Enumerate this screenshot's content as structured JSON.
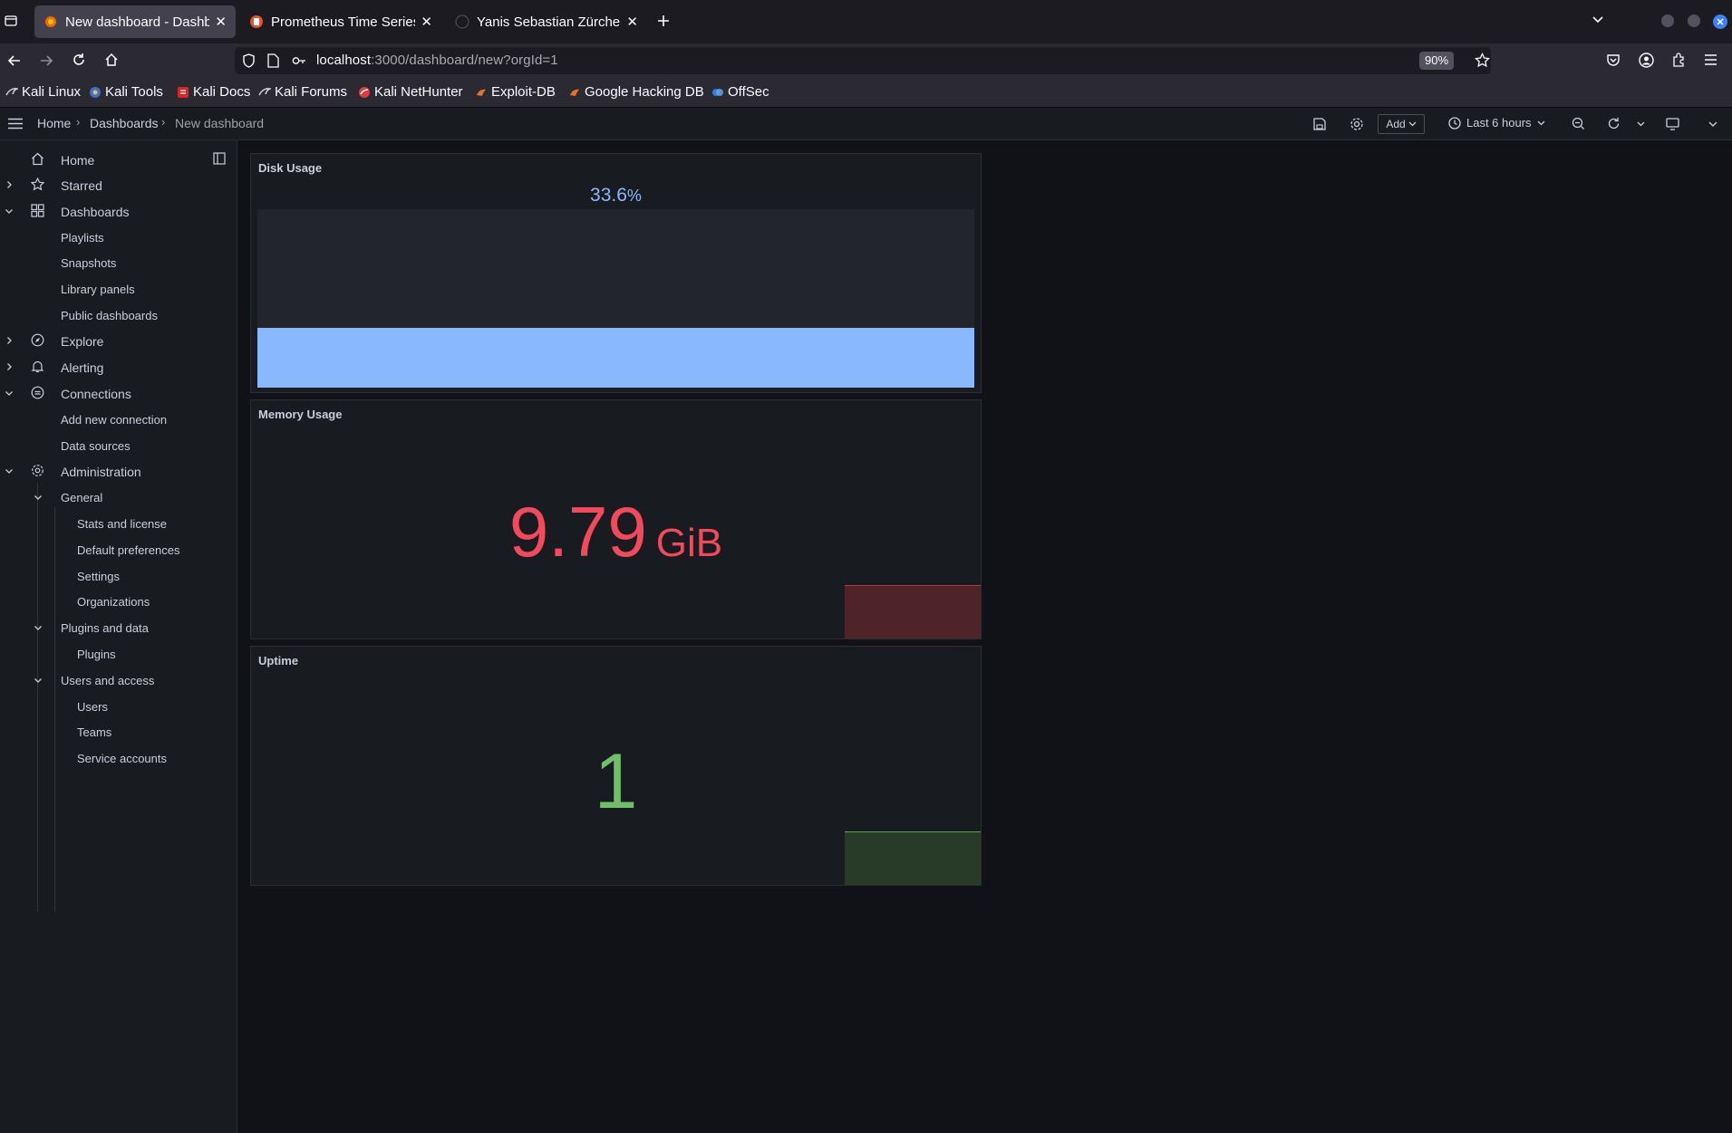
{
  "browser": {
    "tabs": [
      {
        "title": "New dashboard - Dashbo",
        "active": true
      },
      {
        "title": "Prometheus Time Series C",
        "active": false
      },
      {
        "title": "Yanis Sebastian Zürcher -",
        "active": false
      }
    ],
    "url": {
      "host": "localhost",
      "rest": ":3000/dashboard/new?orgId=1"
    },
    "zoom": "90%",
    "bookmarks": [
      "Kali Linux",
      "Kali Tools",
      "Kali Docs",
      "Kali Forums",
      "Kali NetHunter",
      "Exploit-DB",
      "Google Hacking DB",
      "OffSec"
    ]
  },
  "topbar": {
    "breadcrumbs": [
      "Home",
      "Dashboards",
      "New dashboard"
    ],
    "add_label": "Add",
    "time_range": "Last 6 hours"
  },
  "sidebar": {
    "items": [
      {
        "label": "Home",
        "icon": "home-icon"
      },
      {
        "label": "Starred",
        "icon": "star-icon"
      },
      {
        "label": "Dashboards",
        "icon": "dashboards-grid-icon"
      },
      {
        "label": "Playlists"
      },
      {
        "label": "Snapshots"
      },
      {
        "label": "Library panels"
      },
      {
        "label": "Public dashboards"
      },
      {
        "label": "Explore",
        "icon": "compass-icon"
      },
      {
        "label": "Alerting",
        "icon": "bell-icon"
      },
      {
        "label": "Connections",
        "icon": "connections-icon"
      },
      {
        "label": "Add new connection"
      },
      {
        "label": "Data sources"
      },
      {
        "label": "Administration",
        "icon": "cog-icon"
      },
      {
        "label": "General"
      },
      {
        "label": "Stats and license"
      },
      {
        "label": "Default preferences"
      },
      {
        "label": "Settings"
      },
      {
        "label": "Organizations"
      },
      {
        "label": "Plugins and data"
      },
      {
        "label": "Plugins"
      },
      {
        "label": "Users and access"
      },
      {
        "label": "Users"
      },
      {
        "label": "Teams"
      },
      {
        "label": "Service accounts"
      }
    ]
  },
  "panels": {
    "disk": {
      "title": "Disk Usage",
      "value": "33.6",
      "unit": "%",
      "fill_fraction": 0.336
    },
    "memory": {
      "title": "Memory Usage",
      "value": "9.79",
      "unit": "GiB"
    },
    "uptime": {
      "title": "Uptime",
      "value": "1"
    }
  },
  "colors": {
    "disk": "#8ab8ff",
    "memory": "#f2495c",
    "uptime": "#73bf69"
  }
}
